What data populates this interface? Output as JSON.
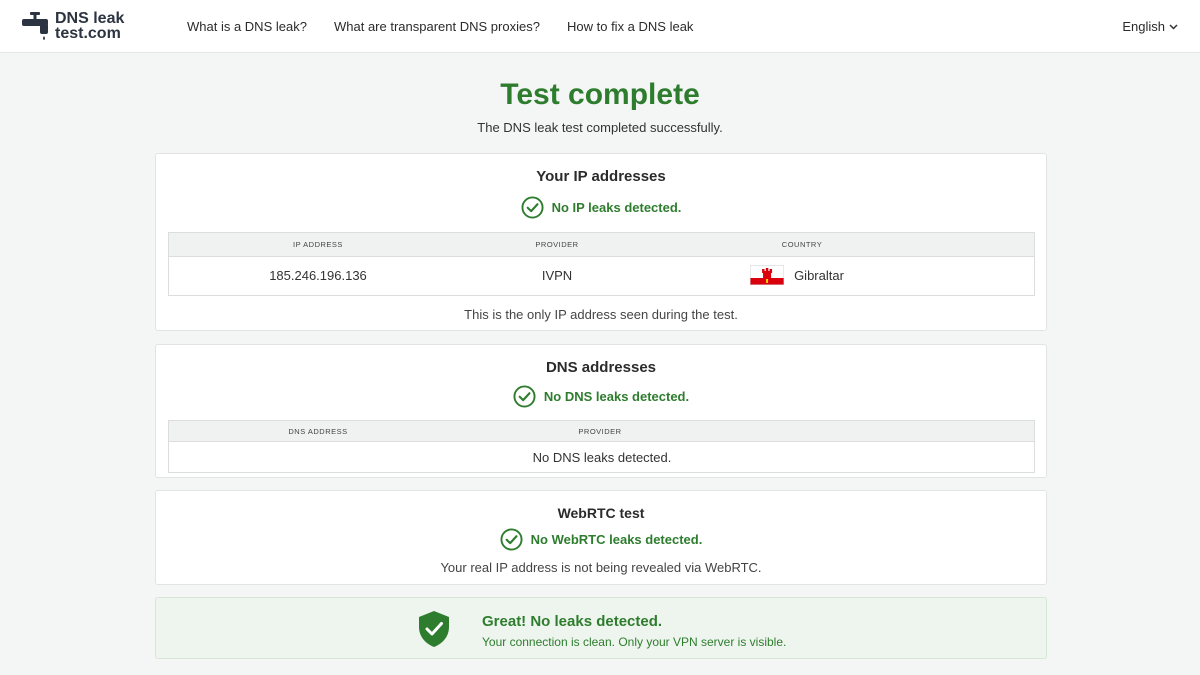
{
  "header": {
    "logo_line1": "DNS leak",
    "logo_line2": "test.com",
    "nav": [
      {
        "label": "What is a DNS leak?"
      },
      {
        "label": "What are transparent DNS proxies?"
      },
      {
        "label": "How to fix a DNS leak"
      }
    ],
    "language": "English",
    "icons": {
      "logo": "faucet-icon",
      "language": "chevron-down-icon"
    }
  },
  "main": {
    "title": "Test complete",
    "subtitle": "The DNS leak test completed successfully."
  },
  "ip_card": {
    "title": "Your IP addresses",
    "status": "No IP leaks detected.",
    "columns": [
      "IP ADDRESS",
      "PROVIDER",
      "COUNTRY"
    ],
    "rows": [
      {
        "ip": "185.246.196.136",
        "provider": "IVPN",
        "country": "Gibraltar",
        "flag_icon": "gibraltar-flag-icon"
      }
    ],
    "note": "This is the only IP address seen during the test."
  },
  "dns_card": {
    "title": "DNS addresses",
    "status": "No DNS leaks detected.",
    "columns": [
      "DNS ADDRESS",
      "PROVIDER"
    ],
    "empty_message": "No DNS leaks detected."
  },
  "webrtc_card": {
    "title": "WebRTC test",
    "status": "No WebRTC leaks detected.",
    "note": "Your real IP address is not being revealed via WebRTC."
  },
  "summary": {
    "title": "Great! No leaks detected.",
    "subtitle": "Your connection is clean. Only your VPN server is visible.",
    "icon": "shield-check-icon"
  },
  "colors": {
    "accent_green": "#2e7d2e",
    "background": "#f4f5f5",
    "summary_bg": "#eef5ee"
  }
}
